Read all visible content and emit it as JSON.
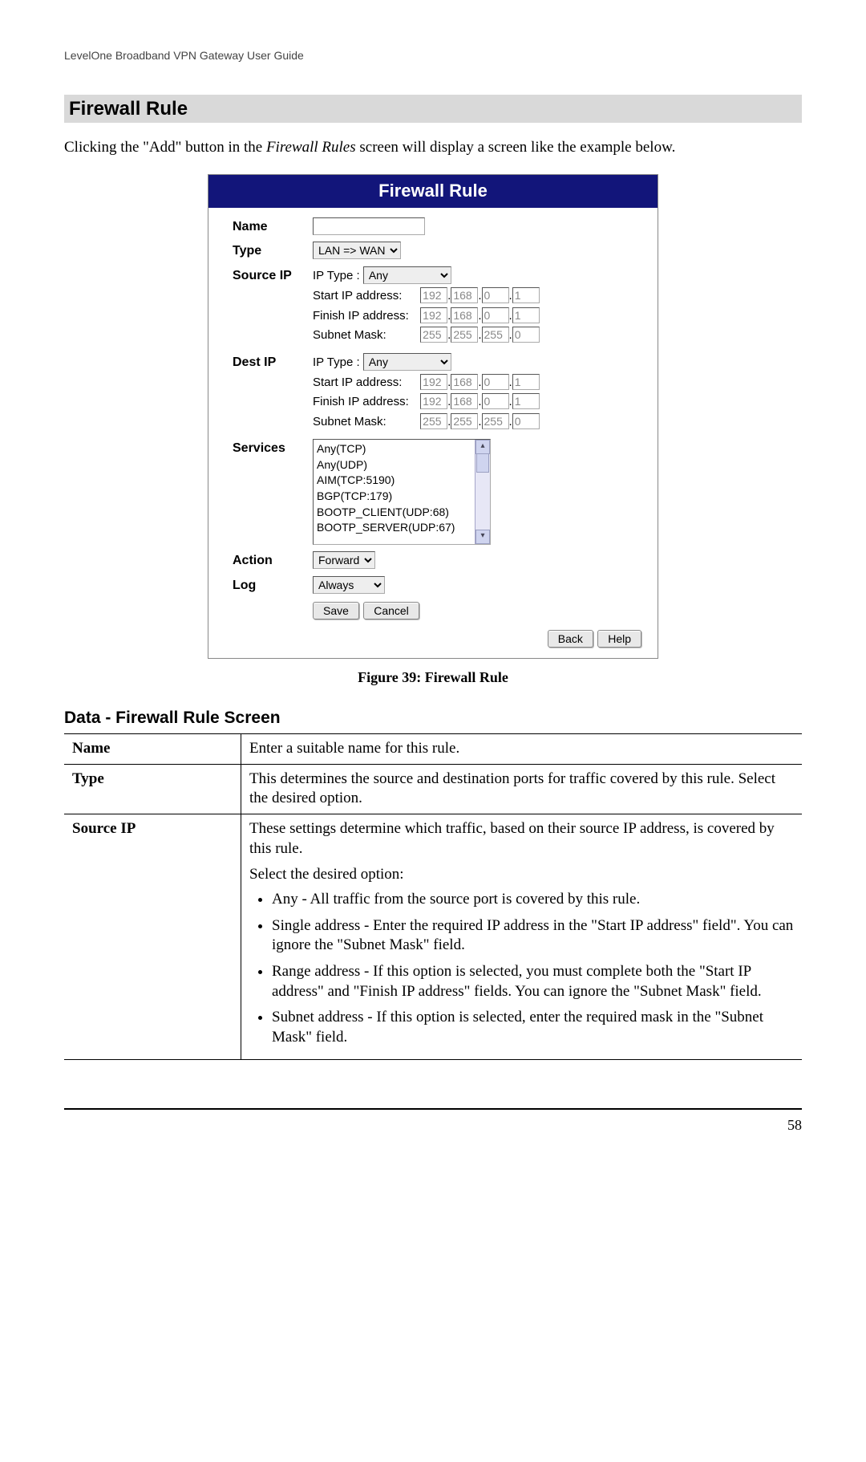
{
  "running_header": "LevelOne Broadband VPN Gateway User Guide",
  "section_title": "Firewall Rule",
  "intro": {
    "pre": "Clicking the \"Add\" button in the ",
    "ital": "Firewall Rules",
    "post": " screen will display a screen like the example below."
  },
  "panel": {
    "title": "Firewall Rule",
    "rows": {
      "name_label": "Name",
      "name_value": "",
      "type_label": "Type",
      "type_value": "LAN => WAN",
      "sourceip_label": "Source IP",
      "destip_label": "Dest IP",
      "ip_type_label": "IP Type :",
      "ip_type_value": "Any",
      "start_ip_label": "Start IP address:",
      "finish_ip_label": "Finish IP address:",
      "subnet_mask_label": "Subnet Mask:",
      "src_start_ip": [
        "192",
        "168",
        "0",
        "1"
      ],
      "src_finish_ip": [
        "192",
        "168",
        "0",
        "1"
      ],
      "src_subnet": [
        "255",
        "255",
        "255",
        "0"
      ],
      "dst_start_ip": [
        "192",
        "168",
        "0",
        "1"
      ],
      "dst_finish_ip": [
        "192",
        "168",
        "0",
        "1"
      ],
      "dst_subnet": [
        "255",
        "255",
        "255",
        "0"
      ],
      "services_label": "Services",
      "services_options": [
        "Any(TCP)",
        "Any(UDP)",
        "AIM(TCP:5190)",
        "BGP(TCP:179)",
        "BOOTP_CLIENT(UDP:68)",
        "BOOTP_SERVER(UDP:67)"
      ],
      "action_label": "Action",
      "action_value": "Forward",
      "log_label": "Log",
      "log_value": "Always"
    },
    "buttons": {
      "save": "Save",
      "cancel": "Cancel",
      "back": "Back",
      "help": "Help"
    }
  },
  "figure_caption": "Figure 39: Firewall Rule",
  "subsection_title": "Data - Firewall Rule Screen",
  "table": {
    "rows": [
      {
        "label": "Name",
        "desc": "Enter a suitable name for this rule."
      },
      {
        "label": "Type",
        "desc": "This determines the source and destination ports for traffic covered by this rule. Select the desired option."
      },
      {
        "label": "Source IP",
        "desc_intro": "These settings determine which traffic, based on their source IP address, is covered by this rule.",
        "desc_select": "Select the desired option:",
        "bullets": [
          "Any - All traffic from the source port is covered by this rule.",
          "Single address - Enter the required IP address in the \"Start IP address\" field\". You can ignore the \"Subnet Mask\" field.",
          "Range address - If this option is selected, you must complete both the \"Start IP address\" and \"Finish IP address\" fields. You can ignore the \"Subnet Mask\" field.",
          "Subnet address - If this option is selected, enter the required mask in the \"Subnet Mask\" field."
        ]
      }
    ]
  },
  "page_number": "58"
}
